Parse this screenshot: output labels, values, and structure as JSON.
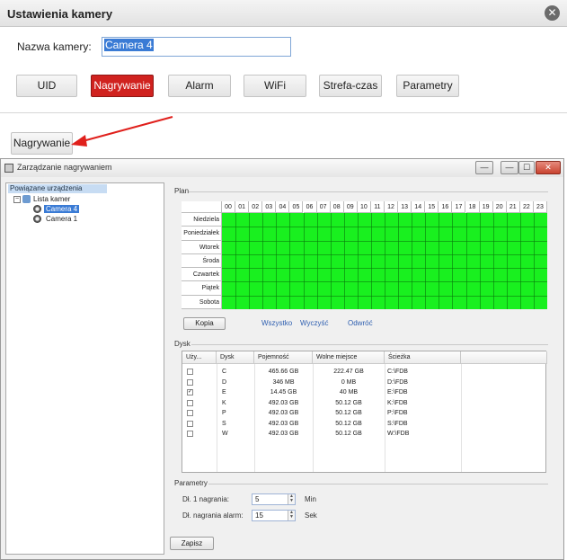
{
  "dialog": {
    "title": "Ustawienia kamery",
    "close_glyph": "✕"
  },
  "camera": {
    "label": "Nazwa kamery:",
    "value": "Camera 4"
  },
  "tabs": [
    {
      "label": "UID"
    },
    {
      "label": "Nagrywanie",
      "active": true
    },
    {
      "label": "Alarm"
    },
    {
      "label": "WiFi"
    },
    {
      "label": "Strefa-czas"
    },
    {
      "label": "Parametry"
    }
  ],
  "record_button": "Nagrywanie",
  "colors": {
    "accent": "#d0221f",
    "schedule_green": "#19f01f",
    "arrow": "#e0201c"
  },
  "window": {
    "title": "Zarządzanie nagrywaniem",
    "buttons": [
      "—",
      "☐",
      "✕"
    ],
    "tree": {
      "root": "Powiązane urządzenia",
      "list": "Lista kamer",
      "items": [
        "Camera 4",
        "Camera 1"
      ]
    },
    "plan": {
      "label": "Plan",
      "hours": [
        "00",
        "01",
        "02",
        "03",
        "04",
        "05",
        "06",
        "07",
        "08",
        "09",
        "10",
        "11",
        "12",
        "13",
        "14",
        "15",
        "16",
        "17",
        "18",
        "19",
        "20",
        "21",
        "22",
        "23"
      ],
      "days": [
        "Niedziela",
        "Poniedziałek",
        "Wtorek",
        "Środa",
        "Czwartek",
        "Piątek",
        "Sobota"
      ],
      "copy_button": "Kopia",
      "links": [
        "Wszystko",
        "Wyczyść",
        "Odwróć"
      ]
    },
    "disk": {
      "label": "Dysk",
      "columns": [
        "Uży...",
        "Dysk",
        "Pojemność",
        "Wolne miejsce",
        "Ścieżka"
      ],
      "rows": [
        {
          "checked": false,
          "drive": "C",
          "capacity": "465.66 GB",
          "free": "222.47 GB",
          "path": "C:\\FDB"
        },
        {
          "checked": false,
          "drive": "D",
          "capacity": "346 MB",
          "free": "0 MB",
          "path": "D:\\FDB"
        },
        {
          "checked": true,
          "drive": "E",
          "capacity": "14.45 GB",
          "free": "40 MB",
          "path": "E:\\FDB"
        },
        {
          "checked": false,
          "drive": "K",
          "capacity": "492.03 GB",
          "free": "50.12 GB",
          "path": "K:\\FDB"
        },
        {
          "checked": false,
          "drive": "P",
          "capacity": "492.03 GB",
          "free": "50.12 GB",
          "path": "P:\\FDB"
        },
        {
          "checked": false,
          "drive": "S",
          "capacity": "492.03 GB",
          "free": "50.12 GB",
          "path": "S:\\FDB"
        },
        {
          "checked": false,
          "drive": "W",
          "capacity": "492.03 GB",
          "free": "50.12 GB",
          "path": "W:\\FDB"
        }
      ]
    },
    "params": {
      "label": "Parametry",
      "length_label": "Dł. 1 nagrania:",
      "length_value": "5",
      "length_unit": "Min",
      "alarm_label": "Dł. nagrania alarm:",
      "alarm_value": "15",
      "alarm_unit": "Sek"
    },
    "close_button": "Zapisz"
  }
}
